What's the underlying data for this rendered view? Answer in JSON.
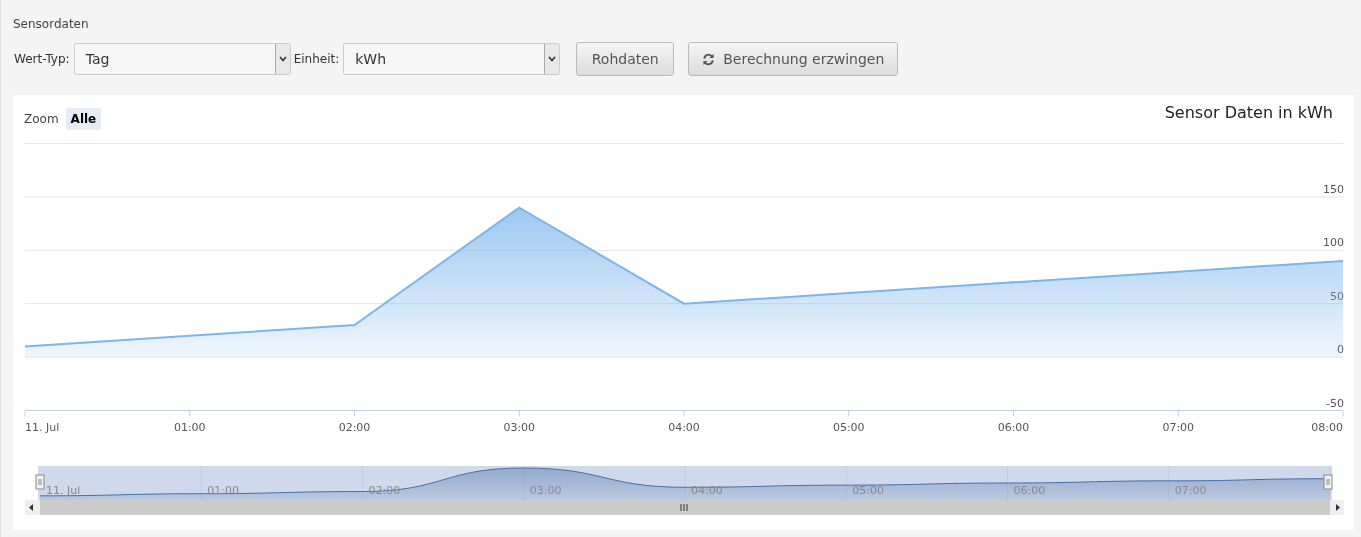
{
  "header": {
    "title": "Sensordaten"
  },
  "filters": [
    {
      "label": "Wert-Typ:",
      "value": "Tag"
    },
    {
      "label": "Einheit:",
      "value": "kWh"
    }
  ],
  "buttons": [
    {
      "label": "Rohdaten",
      "kind": "plain"
    },
    {
      "label": "Berechnung erzwingen",
      "kind": "refresh"
    }
  ],
  "chart": {
    "zoom_label": "Zoom",
    "zoom_buttons": [
      {
        "label": "Alle",
        "selected": true
      }
    ],
    "chart_data": {
      "type": "area",
      "title": "Sensor Daten in kWh",
      "categories": [
        "11. Jul",
        "01:00",
        "02:00",
        "03:00",
        "04:00",
        "05:00",
        "06:00",
        "07:00",
        "08:00"
      ],
      "series": [
        {
          "color": "#7cb5ec",
          "values": [
            10,
            20,
            30,
            140,
            50,
            60,
            70,
            80,
            90
          ]
        }
      ],
      "ylim": [
        -50,
        200
      ],
      "yticks": [
        -50,
        0,
        50,
        100,
        150
      ],
      "grid": true
    },
    "navigator": {
      "labels": [
        "11. Jul",
        "01:00",
        "02:00",
        "03:00",
        "04:00",
        "05:00",
        "06:00",
        "07:00"
      ]
    }
  }
}
